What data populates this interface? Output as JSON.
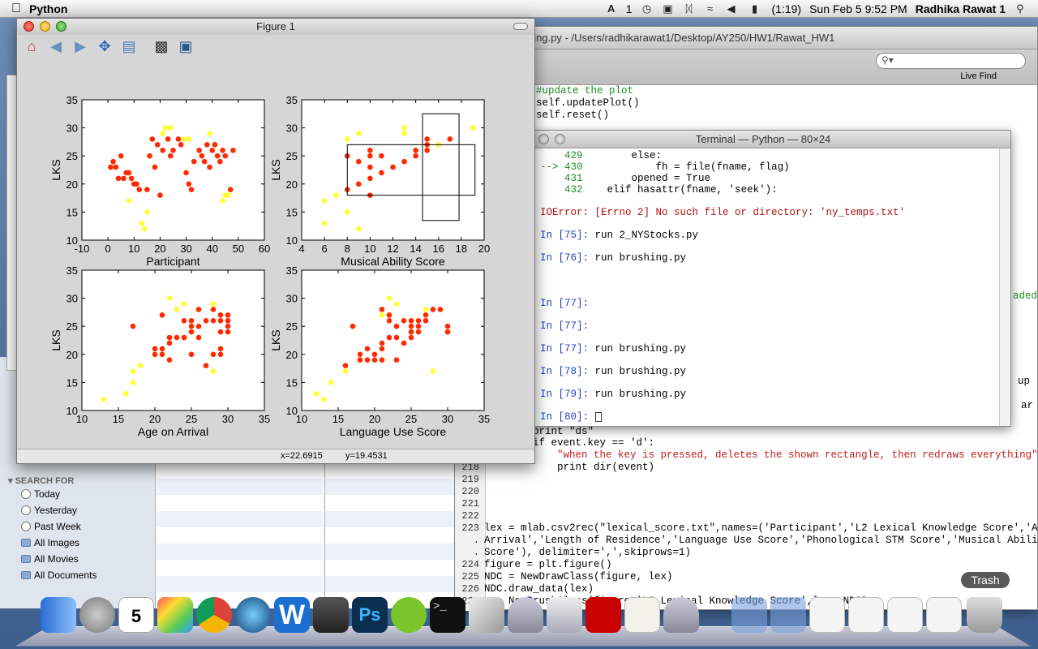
{
  "menubar": {
    "app_name": "Python",
    "status_items": [
      "1",
      "(1:19)",
      "Sun Feb 5  9:52 PM",
      "Radhika Rawat 1"
    ]
  },
  "editor": {
    "title": "hing.py - /Users/radhikarawat1/Desktop/AY250/HW1/Rawat_HW1",
    "search_placeholder": "",
    "live_find_label": "Live Find",
    "top_lines": [
      "#update the plot",
      "self.updatePlot()",
      "self.reset()"
    ],
    "side_fragment_a": "aded",
    "side_fragment_b": "up",
    "side_fragment_c": "ar",
    "mid_lines": [
      "print \"ds\"",
      "if event.key == 'd':",
      "    \"when the key is pressed, deletes the shown rectangle, then redraws everything\"",
      "    print dir(event)"
    ],
    "numbered": [
      {
        "n": "218",
        "t": ""
      },
      {
        "n": "219",
        "t": ""
      },
      {
        "n": "220",
        "t": ""
      },
      {
        "n": "221",
        "t": ""
      },
      {
        "n": "222",
        "t": ""
      },
      {
        "n": "223",
        "t": "lex = mlab.csv2rec(\"lexical_score.txt\",names=('Participant','L2 Lexical Knowledge Score','Age on"
      },
      {
        "n": ".",
        "t": "Arrival','Length of Residence','Language Use Score','Phonological STM Score','Musical Ability"
      },
      {
        "n": ".",
        "t": "Score'), delimiter=',',skiprows=1)"
      },
      {
        "n": "224",
        "t": "figure = plt.figure()"
      },
      {
        "n": "225",
        "t": "NDC = NewDrawClass(figure, lex)"
      },
      {
        "n": "226",
        "t": "NDC.draw_data(lex)"
      },
      {
        "n": "227",
        "t": "x = NewBrushClass(figure,'L2 Lexical Knowledge Score',lex, NDC)"
      }
    ]
  },
  "terminal": {
    "title": "Terminal — Python — 80×24",
    "lines": [
      {
        "num": "429",
        "arrow": "",
        "code": "        else:"
      },
      {
        "num": "430",
        "arrow": "--> ",
        "code": "            fh = file(fname, flag)"
      },
      {
        "num": "431",
        "arrow": "",
        "code": "        opened = True"
      },
      {
        "num": "432",
        "arrow": "",
        "code": "    elif hasattr(fname, 'seek'):"
      },
      {
        "num": "",
        "arrow": "",
        "code": ""
      },
      {
        "num": "",
        "arrow": "",
        "code": "IOError: [Errno 2] No such file or directory: 'ny_temps.txt'"
      },
      {
        "num": "",
        "arrow": "",
        "code": ""
      },
      {
        "num": "",
        "arrow": "",
        "code": "In [75]: run 2_NYStocks.py"
      },
      {
        "num": "",
        "arrow": "",
        "code": ""
      },
      {
        "num": "",
        "arrow": "",
        "code": "In [76]: run brushing.py"
      },
      {
        "num": "",
        "arrow": "",
        "code": ""
      },
      {
        "num": "",
        "arrow": "",
        "code": ""
      },
      {
        "num": "",
        "arrow": "",
        "code": ""
      },
      {
        "num": "",
        "arrow": "",
        "code": "In [77]:"
      },
      {
        "num": "",
        "arrow": "",
        "code": ""
      },
      {
        "num": "",
        "arrow": "",
        "code": "In [77]:"
      },
      {
        "num": "",
        "arrow": "",
        "code": ""
      },
      {
        "num": "",
        "arrow": "",
        "code": "In [77]: run brushing.py"
      },
      {
        "num": "",
        "arrow": "",
        "code": ""
      },
      {
        "num": "",
        "arrow": "",
        "code": "In [78]: run brushing.py"
      },
      {
        "num": "",
        "arrow": "",
        "code": ""
      },
      {
        "num": "",
        "arrow": "",
        "code": "In [79]: run brushing.py"
      },
      {
        "num": "",
        "arrow": "",
        "code": ""
      },
      {
        "num": "",
        "arrow": "",
        "code": "In [80]: "
      }
    ]
  },
  "finder": {
    "section_header": "SEARCH FOR",
    "items": [
      {
        "label": "Today",
        "icon": "clock-icon"
      },
      {
        "label": "Yesterday",
        "icon": "clock-icon"
      },
      {
        "label": "Past Week",
        "icon": "clock-icon"
      },
      {
        "label": "All Images",
        "icon": "folder-icon"
      },
      {
        "label": "All Movies",
        "icon": "folder-icon"
      },
      {
        "label": "All Documents",
        "icon": "folder-icon"
      }
    ]
  },
  "figure": {
    "title": "Figure 1",
    "toolbar": [
      "home-icon",
      "back-icon",
      "forward-icon",
      "pan-icon",
      "subplots-icon",
      "configure-icon",
      "save-icon"
    ],
    "status_x": "x=22.6915",
    "status_y": "y=19.4531"
  },
  "dock": {
    "trash_label": "Trash"
  },
  "colors": {
    "selected": "#ff2a00",
    "unselected": "#ffff33"
  },
  "chart_data": [
    {
      "type": "scatter",
      "xlabel": "Participant",
      "ylabel": "LKS",
      "xlim": [
        -10,
        60
      ],
      "ylim": [
        10,
        35
      ],
      "xticks": [
        -10,
        0,
        10,
        20,
        30,
        40,
        50,
        60
      ],
      "yticks": [
        10,
        15,
        20,
        25,
        30,
        35
      ],
      "series": [
        {
          "color": "#ff2a00",
          "points": [
            [
              1,
              23
            ],
            [
              2,
              24
            ],
            [
              3,
              23
            ],
            [
              4,
              21
            ],
            [
              5,
              25
            ],
            [
              6,
              21
            ],
            [
              7,
              22
            ],
            [
              8,
              22
            ],
            [
              9,
              21
            ],
            [
              10,
              20
            ],
            [
              11,
              20
            ],
            [
              12,
              19
            ],
            [
              15,
              19
            ],
            [
              16,
              25
            ],
            [
              17,
              28
            ],
            [
              18,
              23
            ],
            [
              19,
              27
            ],
            [
              20,
              18
            ],
            [
              21,
              26
            ],
            [
              23,
              28
            ],
            [
              24,
              25
            ],
            [
              25,
              26
            ],
            [
              27,
              28
            ],
            [
              28,
              27
            ],
            [
              30,
              22
            ],
            [
              31,
              20
            ],
            [
              32,
              19
            ],
            [
              33,
              24
            ],
            [
              35,
              26
            ],
            [
              36,
              25
            ],
            [
              37,
              24
            ],
            [
              38,
              27
            ],
            [
              39,
              23
            ],
            [
              40,
              26
            ],
            [
              41,
              27
            ],
            [
              42,
              25
            ],
            [
              43,
              24
            ],
            [
              44,
              26
            ],
            [
              45,
              25
            ],
            [
              47,
              19
            ],
            [
              48,
              26
            ]
          ]
        },
        {
          "color": "#ffff33",
          "points": [
            [
              8,
              17
            ],
            [
              13,
              13
            ],
            [
              14,
              12
            ],
            [
              15,
              15
            ],
            [
              21,
              29
            ],
            [
              22,
              30
            ],
            [
              24,
              30
            ],
            [
              29,
              28
            ],
            [
              31,
              28
            ],
            [
              39,
              29
            ],
            [
              44,
              17
            ],
            [
              45,
              18
            ],
            [
              46,
              18
            ]
          ]
        }
      ]
    },
    {
      "type": "scatter",
      "xlabel": "Musical Ability Score",
      "ylabel": "LKS",
      "xlim": [
        4,
        20
      ],
      "ylim": [
        10,
        35
      ],
      "xticks": [
        4,
        6,
        8,
        10,
        12,
        14,
        16,
        18,
        20
      ],
      "yticks": [
        10,
        15,
        20,
        25,
        30,
        35
      ],
      "rectangles": [
        {
          "x0": 8,
          "x1": 19.2,
          "y0": 18,
          "y1": 27
        },
        {
          "x0": 14.6,
          "x1": 17.8,
          "y0": 13.5,
          "y1": 32.5
        }
      ],
      "series": [
        {
          "color": "#ff2a00",
          "points": [
            [
              8,
              25
            ],
            [
              8,
              19
            ],
            [
              9,
              20
            ],
            [
              9,
              24
            ],
            [
              10,
              26
            ],
            [
              10,
              25
            ],
            [
              10,
              23
            ],
            [
              10,
              21
            ],
            [
              10,
              18
            ],
            [
              11,
              25
            ],
            [
              11,
              22
            ],
            [
              12,
              23
            ],
            [
              13,
              24
            ],
            [
              14,
              26
            ],
            [
              14,
              25
            ],
            [
              15,
              26
            ],
            [
              15,
              27
            ],
            [
              15,
              28
            ],
            [
              16,
              27
            ],
            [
              17,
              28
            ]
          ]
        },
        {
          "color": "#ffff33",
          "points": [
            [
              6,
              17
            ],
            [
              6,
              13
            ],
            [
              7,
              18
            ],
            [
              8,
              28
            ],
            [
              8,
              15
            ],
            [
              9,
              29
            ],
            [
              9,
              12
            ],
            [
              13,
              30
            ],
            [
              13,
              29
            ],
            [
              16,
              27
            ],
            [
              19,
              30
            ]
          ]
        }
      ]
    },
    {
      "type": "scatter",
      "xlabel": "Age on Arrival",
      "ylabel": "LKS",
      "xlim": [
        10,
        35
      ],
      "ylim": [
        10,
        35
      ],
      "xticks": [
        10,
        15,
        20,
        25,
        30,
        35
      ],
      "yticks": [
        10,
        15,
        20,
        25,
        30,
        35
      ],
      "series": [
        {
          "color": "#ff2a00",
          "points": [
            [
              17,
              25
            ],
            [
              20,
              21
            ],
            [
              20,
              20
            ],
            [
              21,
              27
            ],
            [
              21,
              21
            ],
            [
              21,
              20
            ],
            [
              22,
              23
            ],
            [
              22,
              22
            ],
            [
              22,
              19
            ],
            [
              23,
              28
            ],
            [
              23,
              23
            ],
            [
              24,
              23
            ],
            [
              24,
              26
            ],
            [
              25,
              26
            ],
            [
              25,
              25
            ],
            [
              25,
              24
            ],
            [
              25,
              20
            ],
            [
              26,
              28
            ],
            [
              26,
              25
            ],
            [
              26,
              23
            ],
            [
              27,
              26
            ],
            [
              27,
              18
            ],
            [
              28,
              28
            ],
            [
              28,
              26
            ],
            [
              28,
              20
            ],
            [
              29,
              27
            ],
            [
              29,
              26
            ],
            [
              29,
              24
            ],
            [
              29,
              21
            ],
            [
              29,
              20
            ],
            [
              30,
              27
            ],
            [
              30,
              26
            ],
            [
              30,
              25
            ],
            [
              30,
              24
            ]
          ]
        },
        {
          "color": "#ffff33",
          "points": [
            [
              13,
              12
            ],
            [
              16,
              13
            ],
            [
              17,
              15
            ],
            [
              17,
              17
            ],
            [
              18,
              18
            ],
            [
              22,
              30
            ],
            [
              23,
              28
            ],
            [
              24,
              29
            ],
            [
              28,
              29
            ],
            [
              28,
              17
            ]
          ]
        }
      ]
    },
    {
      "type": "scatter",
      "xlabel": "Language Use Score",
      "ylabel": "LKS",
      "xlim": [
        10,
        35
      ],
      "ylim": [
        10,
        35
      ],
      "xticks": [
        10,
        15,
        20,
        25,
        30,
        35
      ],
      "yticks": [
        10,
        15,
        20,
        25,
        30,
        35
      ],
      "series": [
        {
          "color": "#ff2a00",
          "points": [
            [
              16,
              18
            ],
            [
              17,
              25
            ],
            [
              18,
              19
            ],
            [
              18,
              20
            ],
            [
              19,
              19
            ],
            [
              19,
              21
            ],
            [
              20,
              20
            ],
            [
              20,
              19
            ],
            [
              21,
              22
            ],
            [
              21,
              19
            ],
            [
              21,
              28
            ],
            [
              21,
              21
            ],
            [
              22,
              27
            ],
            [
              22,
              26
            ],
            [
              22,
              23
            ],
            [
              23,
              19
            ],
            [
              23,
              23
            ],
            [
              23,
              25
            ],
            [
              24,
              26
            ],
            [
              24,
              22
            ],
            [
              25,
              26
            ],
            [
              25,
              25
            ],
            [
              25,
              24
            ],
            [
              25,
              23
            ],
            [
              26,
              26
            ],
            [
              26,
              25
            ],
            [
              26,
              24
            ],
            [
              27,
              27
            ],
            [
              27,
              26
            ],
            [
              28,
              28
            ],
            [
              29,
              28
            ],
            [
              30,
              25
            ],
            [
              30,
              24
            ]
          ]
        },
        {
          "color": "#ffff33",
          "points": [
            [
              12,
              13
            ],
            [
              13,
              12
            ],
            [
              14,
              15
            ],
            [
              16,
              17
            ],
            [
              21,
              27
            ],
            [
              22,
              30
            ],
            [
              23,
              29
            ],
            [
              27,
              28
            ],
            [
              28,
              17
            ]
          ]
        }
      ]
    }
  ]
}
